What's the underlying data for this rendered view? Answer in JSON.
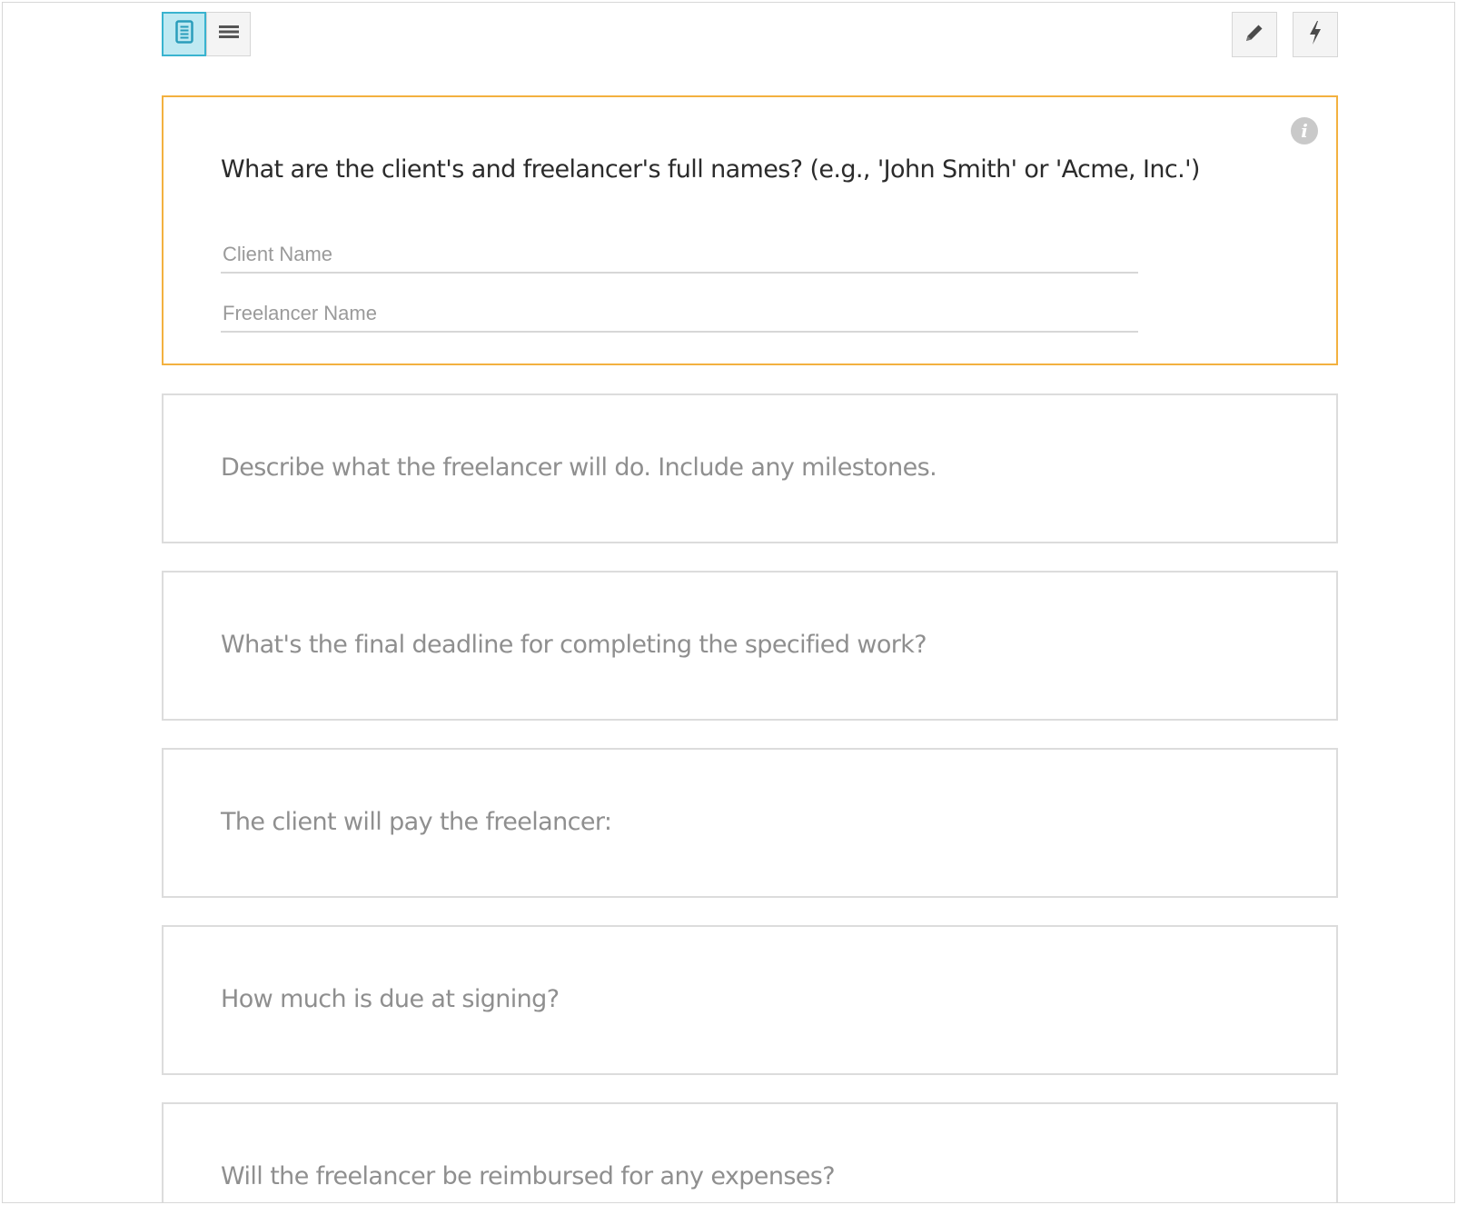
{
  "toolbar": {
    "view_toggle": [
      {
        "icon": "document-icon",
        "active": true
      },
      {
        "icon": "list-icon",
        "active": false
      }
    ],
    "right_buttons": [
      {
        "icon": "pencil-icon"
      },
      {
        "icon": "lightning-icon"
      }
    ]
  },
  "colors": {
    "active_card_border": "#f3b13f",
    "toggle_active_bg": "#bfe9f2",
    "toggle_active_border": "#39b3cf",
    "card_border": "#dcdcdc"
  },
  "questions": [
    {
      "text": "What are the client's and freelancer's full names? (e.g., 'John Smith' or 'Acme, Inc.')",
      "active": true,
      "info_icon": "info-icon",
      "fields": [
        {
          "placeholder": "Client Name",
          "value": ""
        },
        {
          "placeholder": "Freelancer Name",
          "value": ""
        }
      ]
    },
    {
      "text": "Describe what the freelancer will do. Include any milestones.",
      "active": false
    },
    {
      "text": "What's the final deadline for completing the specified work?",
      "active": false
    },
    {
      "text": "The client will pay the freelancer:",
      "active": false
    },
    {
      "text": "How much is due at signing?",
      "active": false
    },
    {
      "text": "Will the freelancer be reimbursed for any expenses?",
      "active": false
    }
  ]
}
